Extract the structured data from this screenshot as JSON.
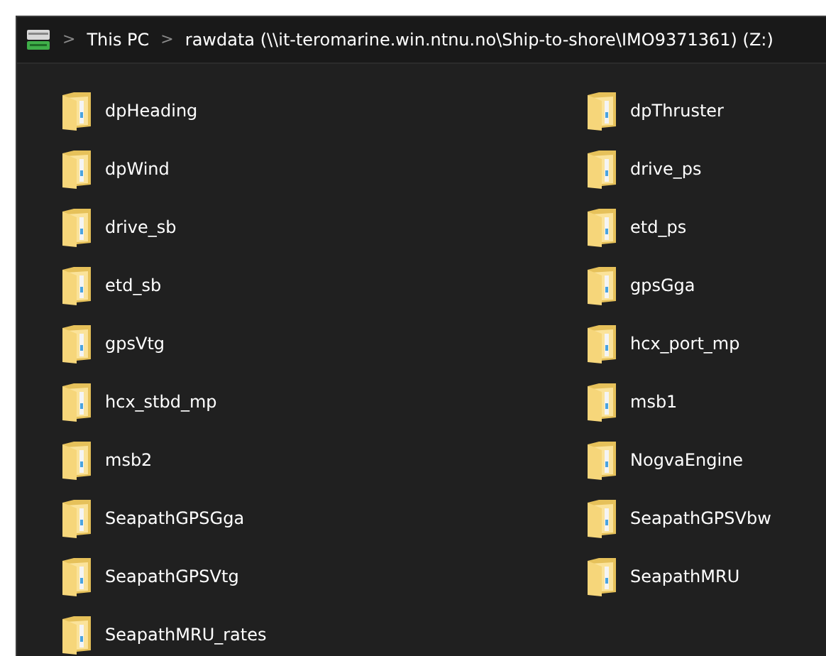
{
  "address_bar": {
    "path": [
      {
        "label": "This PC"
      },
      {
        "label": "rawdata (\\\\it-teromarine.win.ntnu.no\\Ship-to-shore\\IMO9371361) (Z:)"
      }
    ],
    "separator": ">"
  },
  "folders": [
    {
      "name": "dpHeading"
    },
    {
      "name": "dpThruster"
    },
    {
      "name": "dpWind"
    },
    {
      "name": "drive_ps"
    },
    {
      "name": "drive_sb"
    },
    {
      "name": "etd_ps"
    },
    {
      "name": "etd_sb"
    },
    {
      "name": "gpsGga"
    },
    {
      "name": "gpsVtg"
    },
    {
      "name": "hcx_port_mp"
    },
    {
      "name": "hcx_stbd_mp"
    },
    {
      "name": "msb1"
    },
    {
      "name": "msb2"
    },
    {
      "name": "NogvaEngine"
    },
    {
      "name": "SeapathGPSGga"
    },
    {
      "name": "SeapathGPSVbw"
    },
    {
      "name": "SeapathGPSVtg"
    },
    {
      "name": "SeapathMRU"
    },
    {
      "name": "SeapathMRU_rates"
    }
  ]
}
